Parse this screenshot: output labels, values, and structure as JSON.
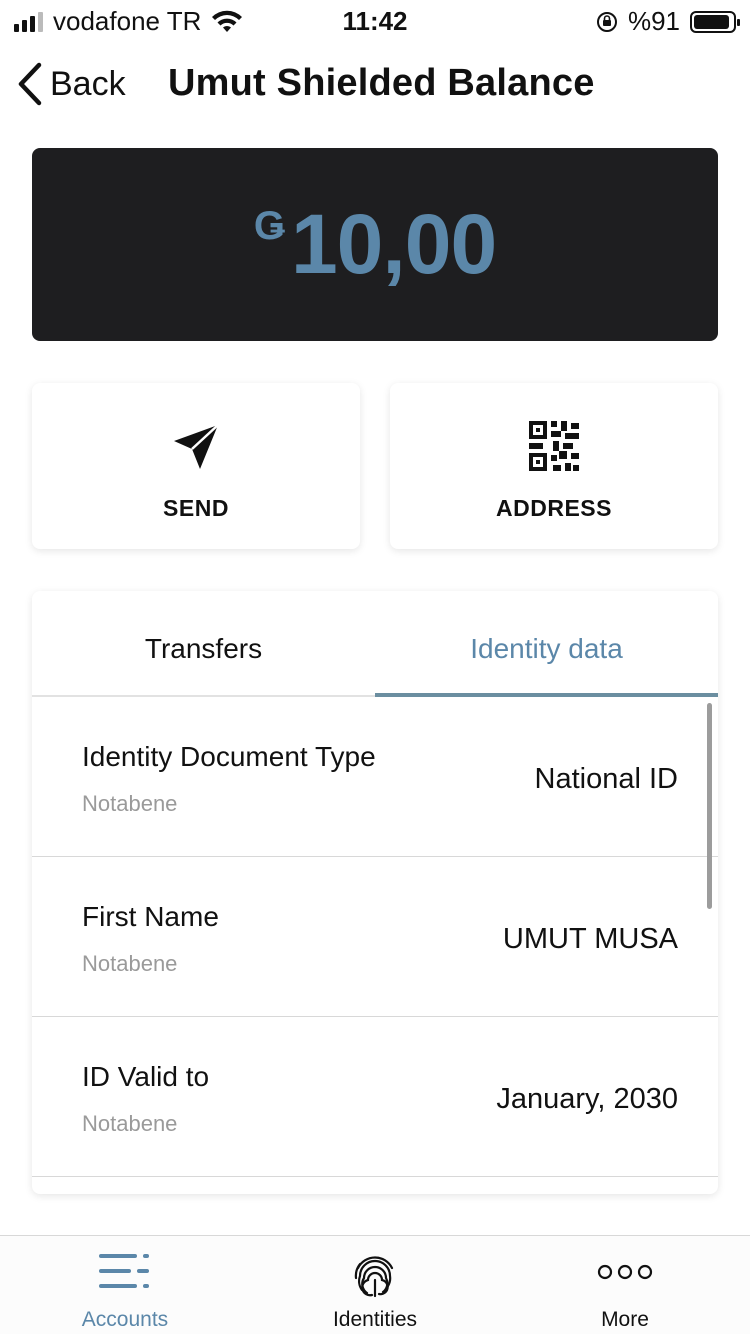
{
  "status_bar": {
    "carrier": "vodafone TR",
    "time": "11:42",
    "battery_text": "%91",
    "battery_level": 0.91
  },
  "nav": {
    "back_label": "Back",
    "title": "Umut Shielded Balance"
  },
  "balance": {
    "currency_symbol": "Ǥ",
    "amount": "10,00"
  },
  "actions": {
    "send_label": "SEND",
    "address_label": "ADDRESS"
  },
  "tabs": {
    "transfers_label": "Transfers",
    "identity_label": "Identity data",
    "active": "Identity data"
  },
  "identity_rows": [
    {
      "label": "Identity Document Type",
      "provider": "Notabene",
      "value": "National ID"
    },
    {
      "label": "First Name",
      "provider": "Notabene",
      "value": "UMUT MUSA"
    },
    {
      "label": "ID Valid to",
      "provider": "Notabene",
      "value": "January, 2030"
    }
  ],
  "tabbar": {
    "accounts_label": "Accounts",
    "identities_label": "Identities",
    "more_label": "More",
    "active": "Accounts"
  },
  "colors": {
    "accent": "#5b87a9",
    "card_bg": "#1e1e20",
    "muted_text": "#9a9a9a"
  },
  "icons": {
    "back": "chevron-left-icon",
    "send": "paper-plane-icon",
    "address": "qr-code-icon",
    "accounts": "list-lines-icon",
    "identities": "fingerprint-icon",
    "more": "three-dots-icon"
  }
}
